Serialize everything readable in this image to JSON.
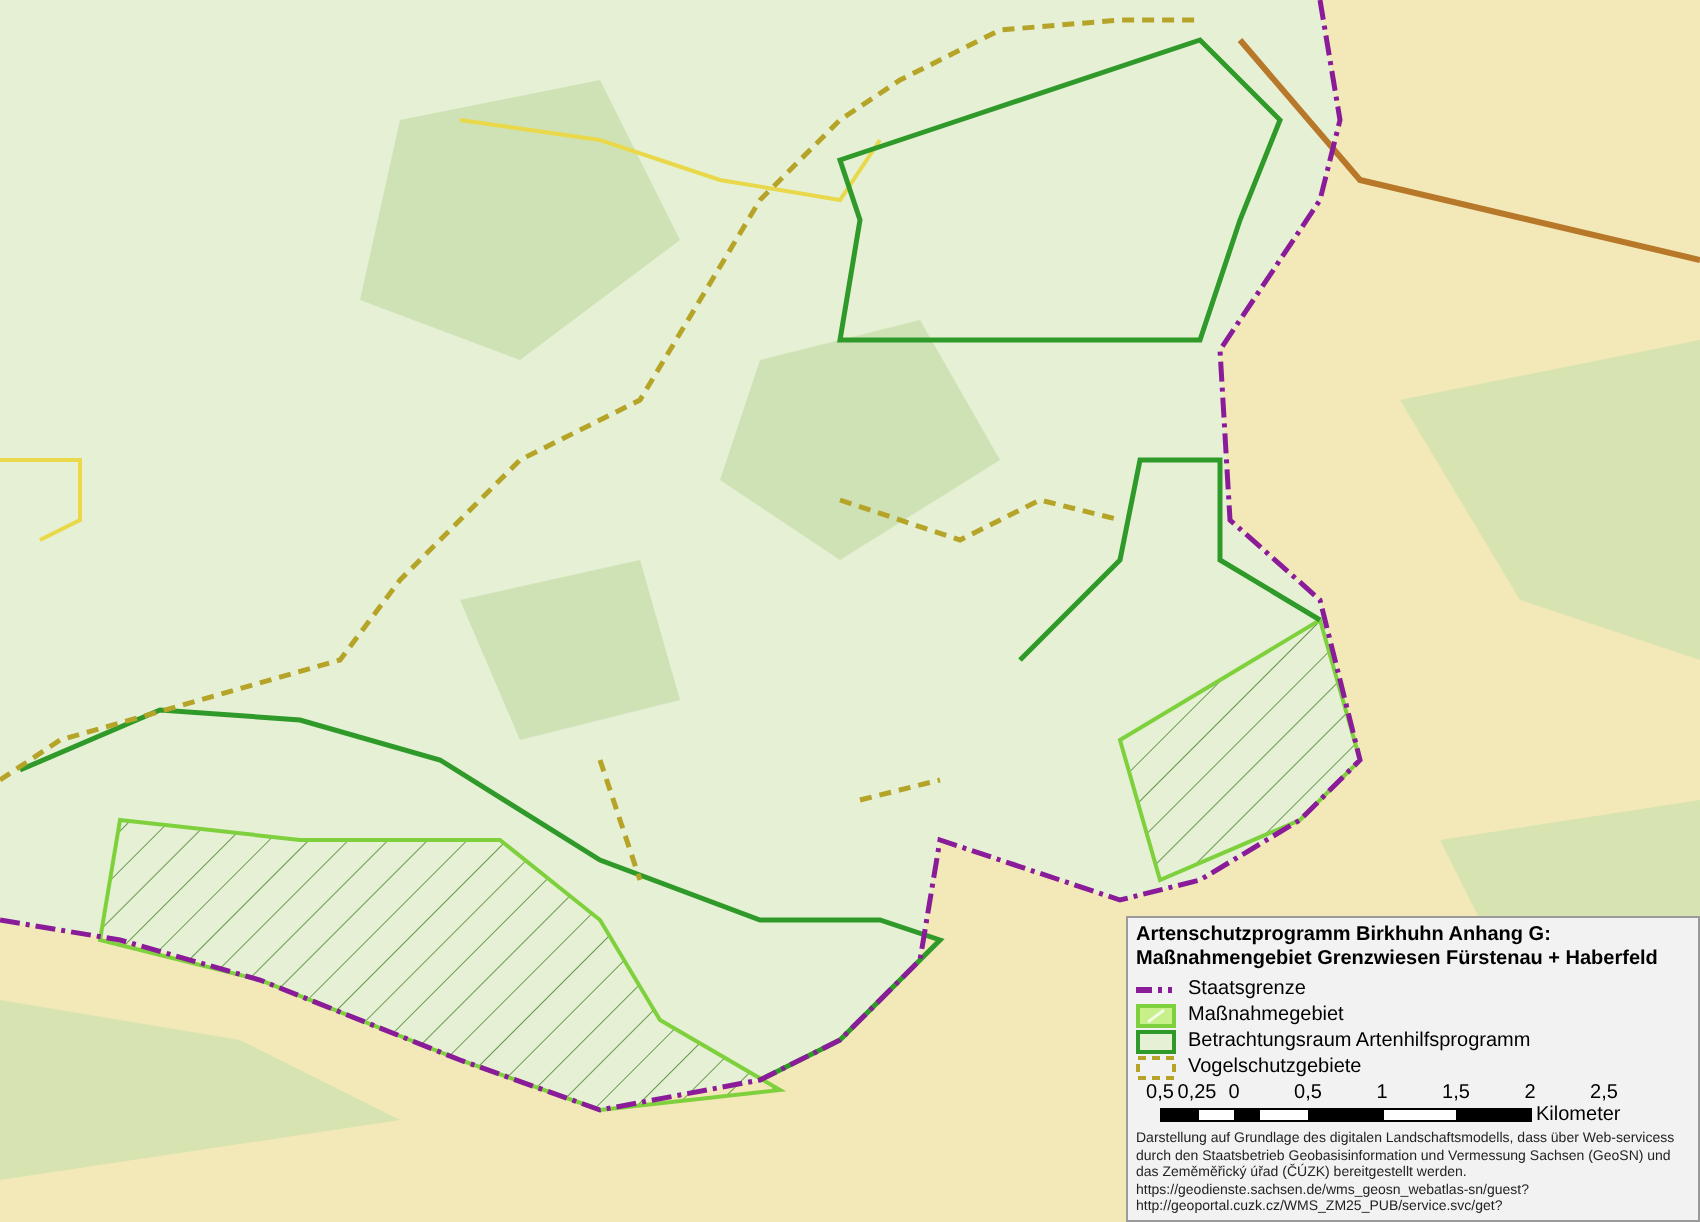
{
  "legend": {
    "title": [
      "Artenschutzprogramm Birkhuhn Anhang G:",
      "Maßnahmengebiet Grenzwiesen Fürstenau + Haberfeld"
    ],
    "entries": [
      {
        "kind": "dashdot",
        "label": "Staatsgrenze"
      },
      {
        "kind": "hatch",
        "label": "Maßnahmegebiet"
      },
      {
        "kind": "outline",
        "label": "Betrachtungsraum Artenhilfsprogramm"
      },
      {
        "kind": "dashed",
        "label": "Vogelschutzgebiete"
      }
    ],
    "scale": {
      "ticks": [
        "0,5",
        "0,25",
        "0",
        "0,5",
        "1",
        "1,5",
        "2",
        "2,5"
      ],
      "unit": "Kilometer"
    },
    "attribution": "Darstellung auf Grundlage des digitalen Landschaftsmodells, dass über Web-servicess durch den Staatsbetrieb Geobasisinformation und Vermessung Sachsen (GeoSN) und das Zeměměřický úřad (ČÚZK) bereitgestellt werden.",
    "urls": [
      "https://geodienste.sachsen.de/wms_geosn_webatlas-sn/guest?",
      "http://geoportal.cuzk.cz/WMS_ZM25_PUB/service.svc/get?"
    ]
  }
}
